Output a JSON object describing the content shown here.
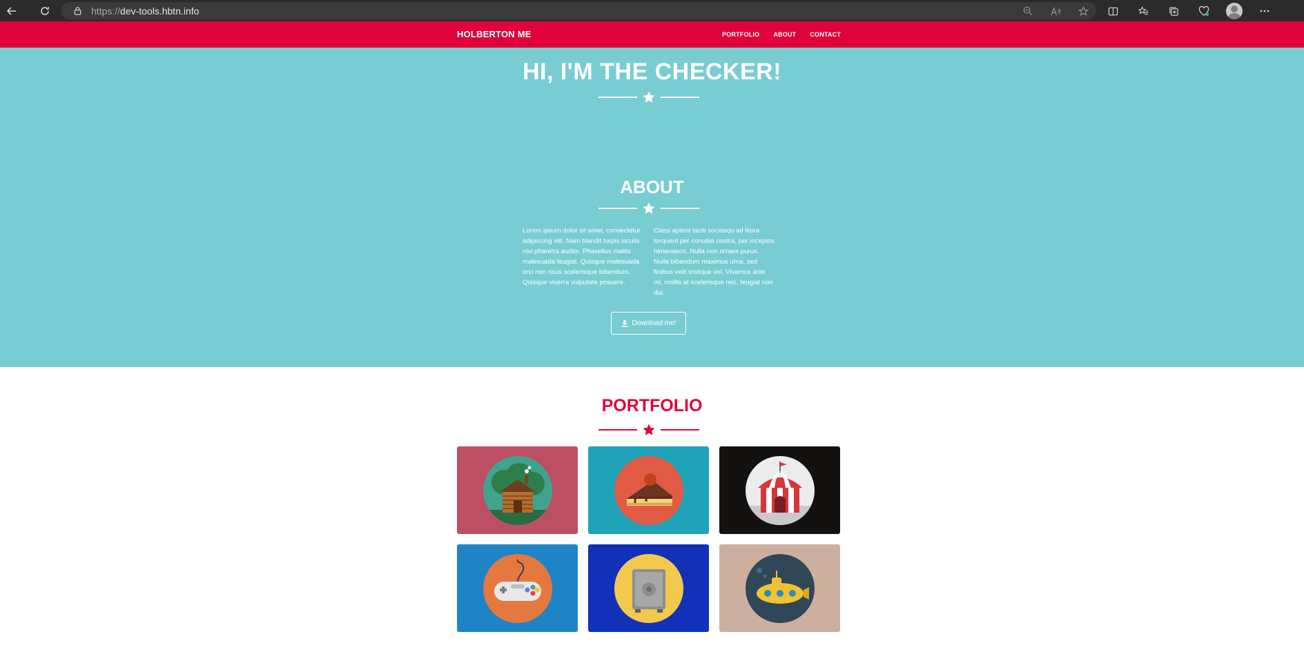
{
  "browser": {
    "url_protocol": "https://",
    "url_host": "dev-tools.hbtn.info"
  },
  "nav": {
    "brand": "HOLBERTON ME",
    "links": [
      "PORTFOLIO",
      "ABOUT",
      "CONTACT"
    ]
  },
  "hero": {
    "title": "HI, I'M THE CHECKER!"
  },
  "about": {
    "title": "ABOUT",
    "col1": "Lorem ipsum dolor sit amet, consectetur adipiscing elit. Nam blandit turpis iaculis nisl pharetra auctor. Phasellus mattis malesuada feugiat. Quisque malesuada orci non risus scelerisque bibendum. Quisque viverra vulputate posuere.",
    "col2": "Class aptent taciti sociosqu ad litora torquent per conubia nostra, per inceptos himenaeos. Nulla non ornare purus. Nulla bibendum maximus urna, sed finibus velit tristique vel. Vivamus ante mi, mollis at scelerisque nec, feugiat non dui.",
    "button": "Download me!"
  },
  "portfolio": {
    "title": "PORTFOLIO",
    "items": [
      {
        "icon": "cabin-icon",
        "bg": "#bd4f63",
        "disc": "#3fa38e"
      },
      {
        "icon": "cake-icon",
        "bg": "#1fa3b8",
        "disc": "#e25b45"
      },
      {
        "icon": "circus-tent-icon",
        "bg": "#141111",
        "disc": "#ececec"
      },
      {
        "icon": "game-controller-icon",
        "bg": "#1f84c6",
        "disc": "#e5783e"
      },
      {
        "icon": "safe-icon",
        "bg": "#1231b8",
        "disc": "#f2c94c"
      },
      {
        "icon": "submarine-icon",
        "bg": "#ccaf9f",
        "disc": "#2f4756"
      }
    ]
  },
  "colors": {
    "nav": "#e0033a",
    "hero": "#78cdd2",
    "accent": "#e0033a"
  }
}
